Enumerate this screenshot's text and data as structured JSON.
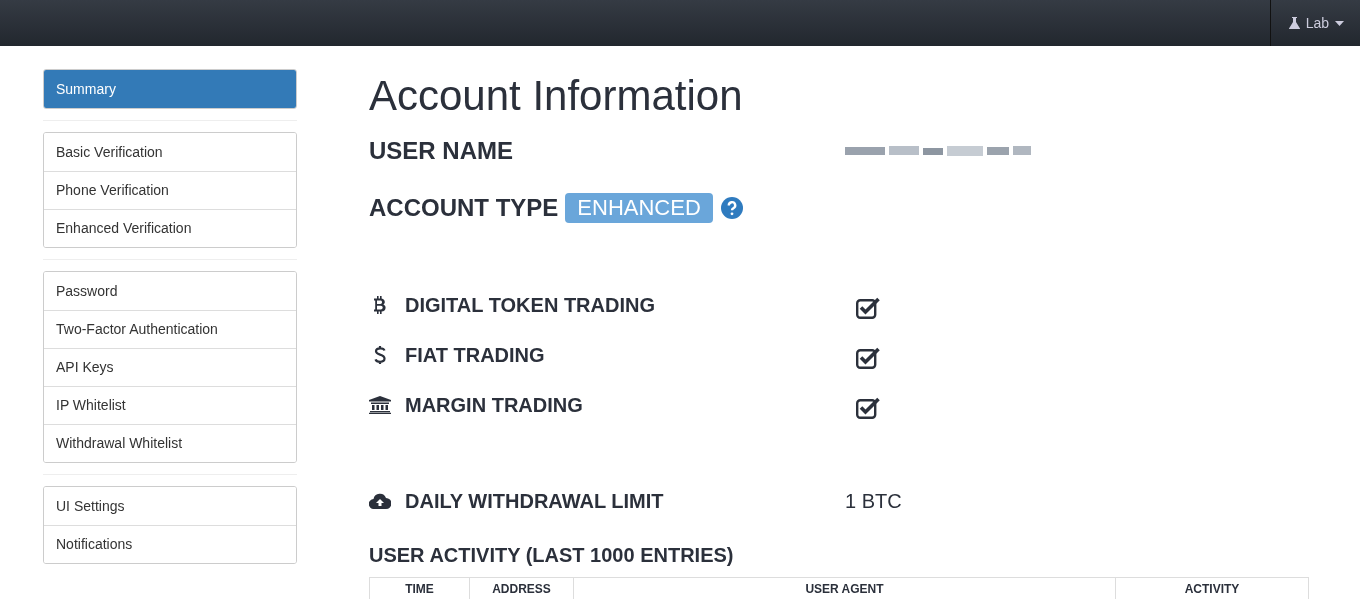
{
  "navbar": {
    "menu": {
      "label": "Lab"
    }
  },
  "sidebar": {
    "groups": [
      [
        {
          "label": "Summary",
          "selected": true
        }
      ],
      [
        {
          "label": "Basic Verification",
          "selected": false
        },
        {
          "label": "Phone Verification",
          "selected": false
        },
        {
          "label": "Enhanced Verification",
          "selected": false
        }
      ],
      [
        {
          "label": "Password",
          "selected": false
        },
        {
          "label": "Two-Factor Authentication",
          "selected": false
        },
        {
          "label": "API Keys",
          "selected": false
        },
        {
          "label": "IP Whitelist",
          "selected": false
        },
        {
          "label": "Withdrawal Whitelist",
          "selected": false
        }
      ],
      [
        {
          "label": "UI Settings",
          "selected": false
        },
        {
          "label": "Notifications",
          "selected": false
        }
      ]
    ]
  },
  "title": "Account Information",
  "user_name": {
    "label": "USER NAME"
  },
  "account_type": {
    "label": "ACCOUNT TYPE",
    "badge": "ENHANCED"
  },
  "permissions": [
    {
      "kind": "token",
      "label": "DIGITAL TOKEN TRADING",
      "checked": true
    },
    {
      "kind": "fiat",
      "label": "FIAT TRADING",
      "checked": true
    },
    {
      "kind": "margin",
      "label": "MARGIN TRADING",
      "checked": true
    }
  ],
  "withdrawal_limit": {
    "label": "DAILY WITHDRAWAL LIMIT",
    "value": "1 BTC"
  },
  "activity": {
    "title": "USER ACTIVITY (LAST 1000 ENTRIES)",
    "columns": [
      "TIME",
      "ADDRESS",
      "USER AGENT",
      "ACTIVITY"
    ]
  }
}
